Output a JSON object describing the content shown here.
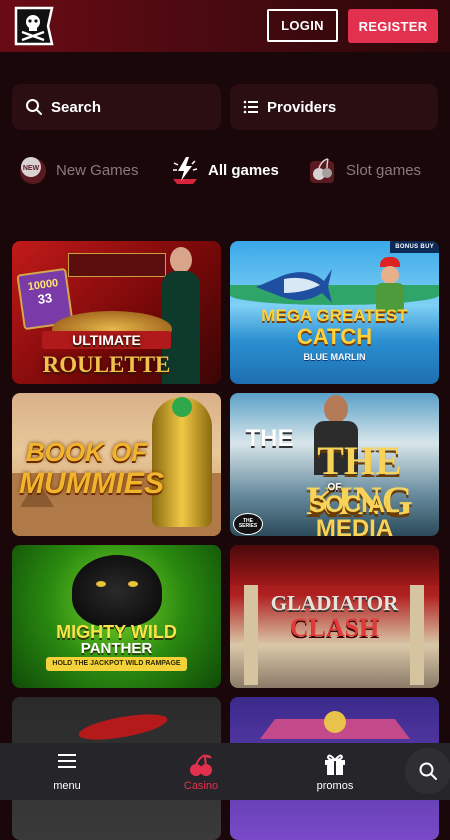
{
  "header": {
    "login_label": "LOGIN",
    "register_label": "REGISTER",
    "accent_color": "#e2304f"
  },
  "search": {
    "label": "Search",
    "icon": "search-icon"
  },
  "providers": {
    "label": "Providers",
    "icon": "list-icon"
  },
  "categories": [
    {
      "label": "New Games",
      "icon": "new-badge-icon",
      "active": false
    },
    {
      "label": "All games",
      "icon": "lightning-icon",
      "active": true
    },
    {
      "label": "Slot games",
      "icon": "cherry-icon",
      "active": false
    }
  ],
  "games": [
    {
      "title_line1": "ULTIMATE",
      "title_line2": "ROULETTE",
      "badge": ""
    },
    {
      "title_line1": "MEGA GREATEST",
      "title_line2": "CATCH",
      "subtitle": "BLUE MARLIN",
      "badge": "BONUS BUY"
    },
    {
      "title_line1": "BOOK OF",
      "title_line2": "MUMMIES",
      "badge": ""
    },
    {
      "title_line1": "THE KING",
      "title_line2": "SOCIAL MEDIA",
      "connector": "OF",
      "corner_badge": "THE SERIES",
      "badge": ""
    },
    {
      "title_line1": "MIGHTY WILD",
      "title_line2": "PANTHER",
      "subtitle": "HOLD THE JACKPOT WILD RAMPAGE",
      "badge": ""
    },
    {
      "title_line1": "GLADIATOR",
      "title_line2": "CLASH",
      "badge": ""
    },
    {
      "title_line1": "",
      "title_line2": "",
      "badge": ""
    },
    {
      "title_line1": "",
      "title_line2": "",
      "badge": ""
    }
  ],
  "roulette_numbers": [
    "10000",
    "33"
  ],
  "bottom_nav": {
    "menu_label": "menu",
    "casino_label": "Casino",
    "promos_label": "promos"
  }
}
